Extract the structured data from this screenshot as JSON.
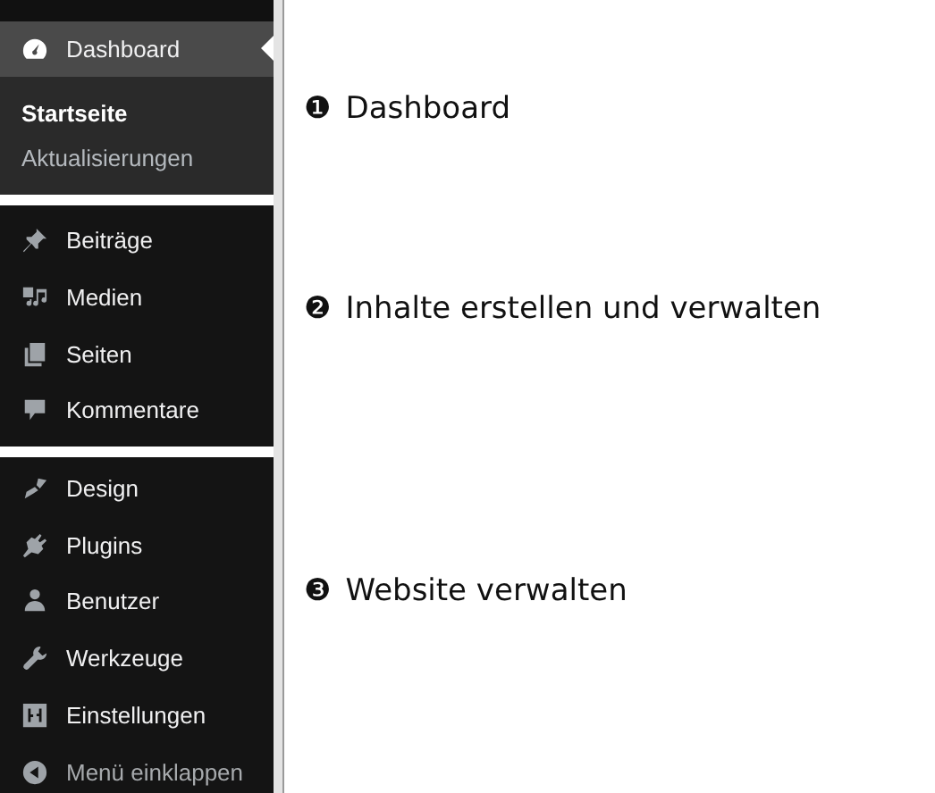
{
  "sidebar": {
    "groups": [
      {
        "items": [
          {
            "label": "Dashboard",
            "kind": "item",
            "selected": true,
            "children": [
              {
                "label": "Startseite",
                "selected": true
              },
              {
                "label": "Aktualisierungen",
                "selected": false
              }
            ]
          }
        ]
      },
      {
        "items": [
          {
            "label": "Beiträge",
            "kind": "item",
            "selected": false
          },
          {
            "label": "Medien",
            "kind": "item",
            "selected": false
          },
          {
            "label": "Seiten",
            "kind": "item",
            "selected": false
          },
          {
            "label": "Kommentare",
            "kind": "item",
            "selected": false
          }
        ]
      },
      {
        "items": [
          {
            "label": "Design",
            "kind": "item",
            "selected": false
          },
          {
            "label": "Plugins",
            "kind": "item",
            "selected": false
          },
          {
            "label": "Benutzer",
            "kind": "item",
            "selected": false
          },
          {
            "label": "Werkzeuge",
            "kind": "item",
            "selected": false
          },
          {
            "label": "Einstellungen",
            "kind": "item",
            "selected": false
          },
          {
            "label": "Menü einklappen",
            "kind": "collapse",
            "selected": false
          }
        ]
      }
    ]
  },
  "annotations": [
    {
      "number": "❶",
      "text": "Dashboard"
    },
    {
      "number": "❷",
      "text": "Inhalte erstellen und verwalten"
    },
    {
      "number": "❸",
      "text": "Website verwalten"
    }
  ]
}
